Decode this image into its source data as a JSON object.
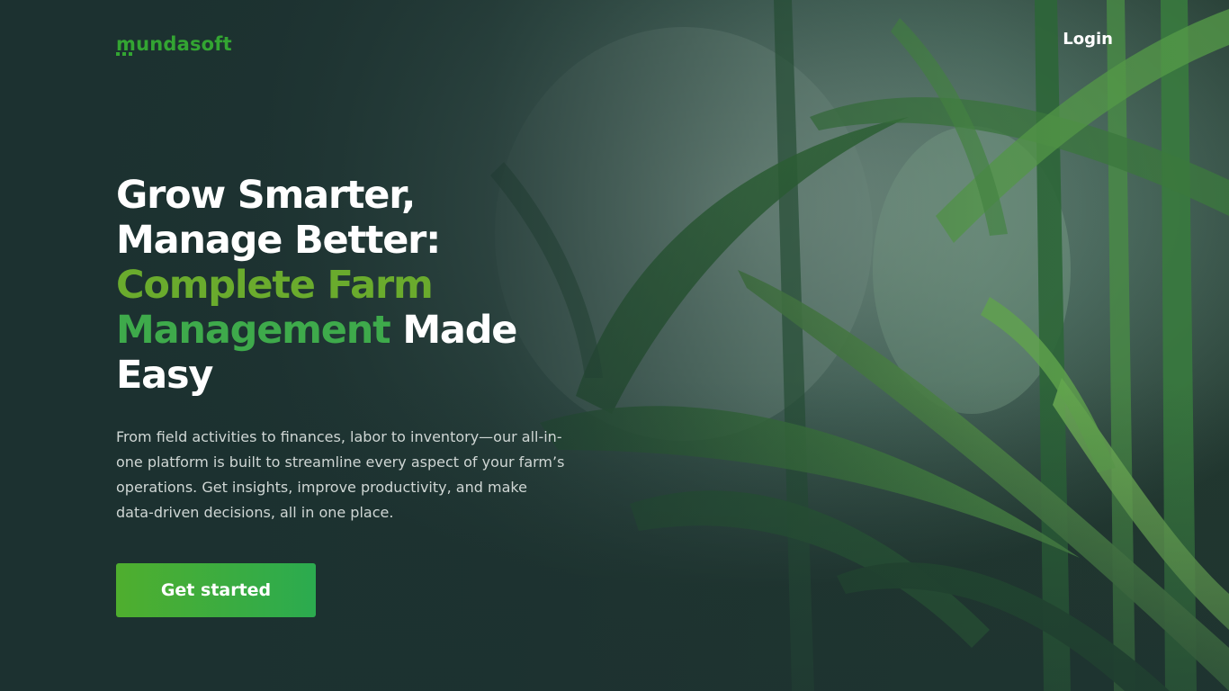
{
  "brand": {
    "logo_text": "mundasoft",
    "logo_color": "#33a532"
  },
  "nav": {
    "login_label": "Login"
  },
  "hero": {
    "title_line_1": "Grow Smarter,",
    "title_line_2": "Manage Better:",
    "title_accent_1": "Complete Farm",
    "title_accent_2": "Management",
    "title_made": "Made",
    "title_easy": "Easy",
    "description": "From field activities to finances, labor to inventory—our all-in-one platform is built to streamline every aspect of your farm’s operations. Get insights, improve productivity, and make data-driven decisions, all in one place.",
    "cta_label": "Get started"
  },
  "colors": {
    "background": "#1c3130",
    "accent_green": "#6aab2d",
    "accent_green_2": "#3eaa4b",
    "button_gradient_start": "#4fae2e",
    "button_gradient_end": "#2bab4f"
  },
  "background_image": {
    "subject": "green crop leaves",
    "icon": "plant-field-image"
  }
}
